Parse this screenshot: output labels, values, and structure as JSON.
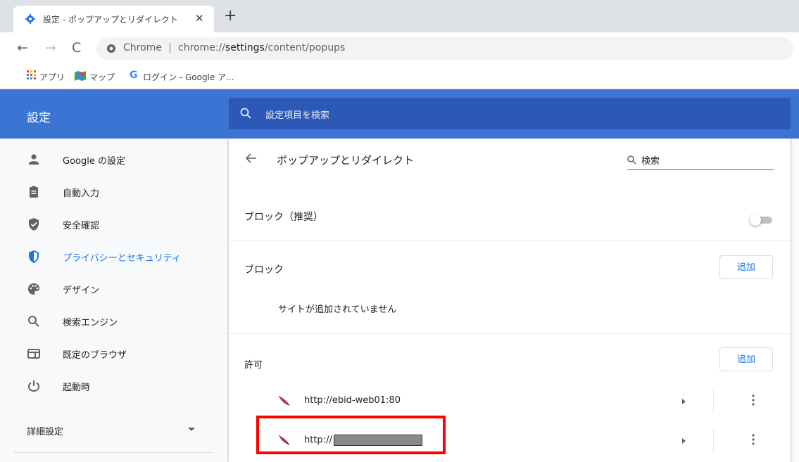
{
  "browser": {
    "tab_title": "設定 - ポップアップとリダイレクト",
    "tab_close": "✕",
    "new_tab": "+",
    "omnibox": {
      "scheme_label": "Chrome",
      "separator": "|",
      "url_prefix": "chrome://",
      "url_host": "settings",
      "url_path": "/content/popups"
    },
    "bookmarks": [
      {
        "label": "アプリ",
        "icon": "apps-grid-icon"
      },
      {
        "label": "マップ",
        "icon": "maps-icon"
      },
      {
        "label": "ログイン - Google ア...",
        "icon": "google-g-icon"
      }
    ]
  },
  "settings": {
    "title": "設定",
    "search_placeholder": "設定項目を検索",
    "sidebar": {
      "items": [
        {
          "label": "Google の設定",
          "icon": "person-icon",
          "active": false
        },
        {
          "label": "自動入力",
          "icon": "clipboard-icon",
          "active": false
        },
        {
          "label": "安全確認",
          "icon": "shield-check-icon",
          "active": false
        },
        {
          "label": "プライバシーとセキュリティ",
          "icon": "shield-icon",
          "active": true
        },
        {
          "label": "デザイン",
          "icon": "palette-icon",
          "active": false
        },
        {
          "label": "検索エンジン",
          "icon": "search-icon",
          "active": false
        },
        {
          "label": "既定のブラウザ",
          "icon": "browser-window-icon",
          "active": false
        },
        {
          "label": "起動時",
          "icon": "power-icon",
          "active": false
        }
      ],
      "advanced": "詳細設定"
    },
    "page": {
      "title": "ポップアップとリダイレクト",
      "search_label": "検索",
      "block_toggle_label": "ブロック（推奨）",
      "block_toggle_on": false,
      "block_section": "ブロック",
      "block_add": "追加",
      "block_empty": "サイトが追加されていません",
      "allow_section": "許可",
      "allow_add": "追加",
      "allowed_sites": [
        {
          "url": "http://ebid-web01:80",
          "redacted": false
        },
        {
          "url": "http://",
          "redacted": true
        }
      ]
    }
  },
  "colors": {
    "header_blue": "#3c74d4",
    "search_blue": "#2c59b8",
    "accent": "#1a73e8",
    "highlight": "#ff0000"
  }
}
